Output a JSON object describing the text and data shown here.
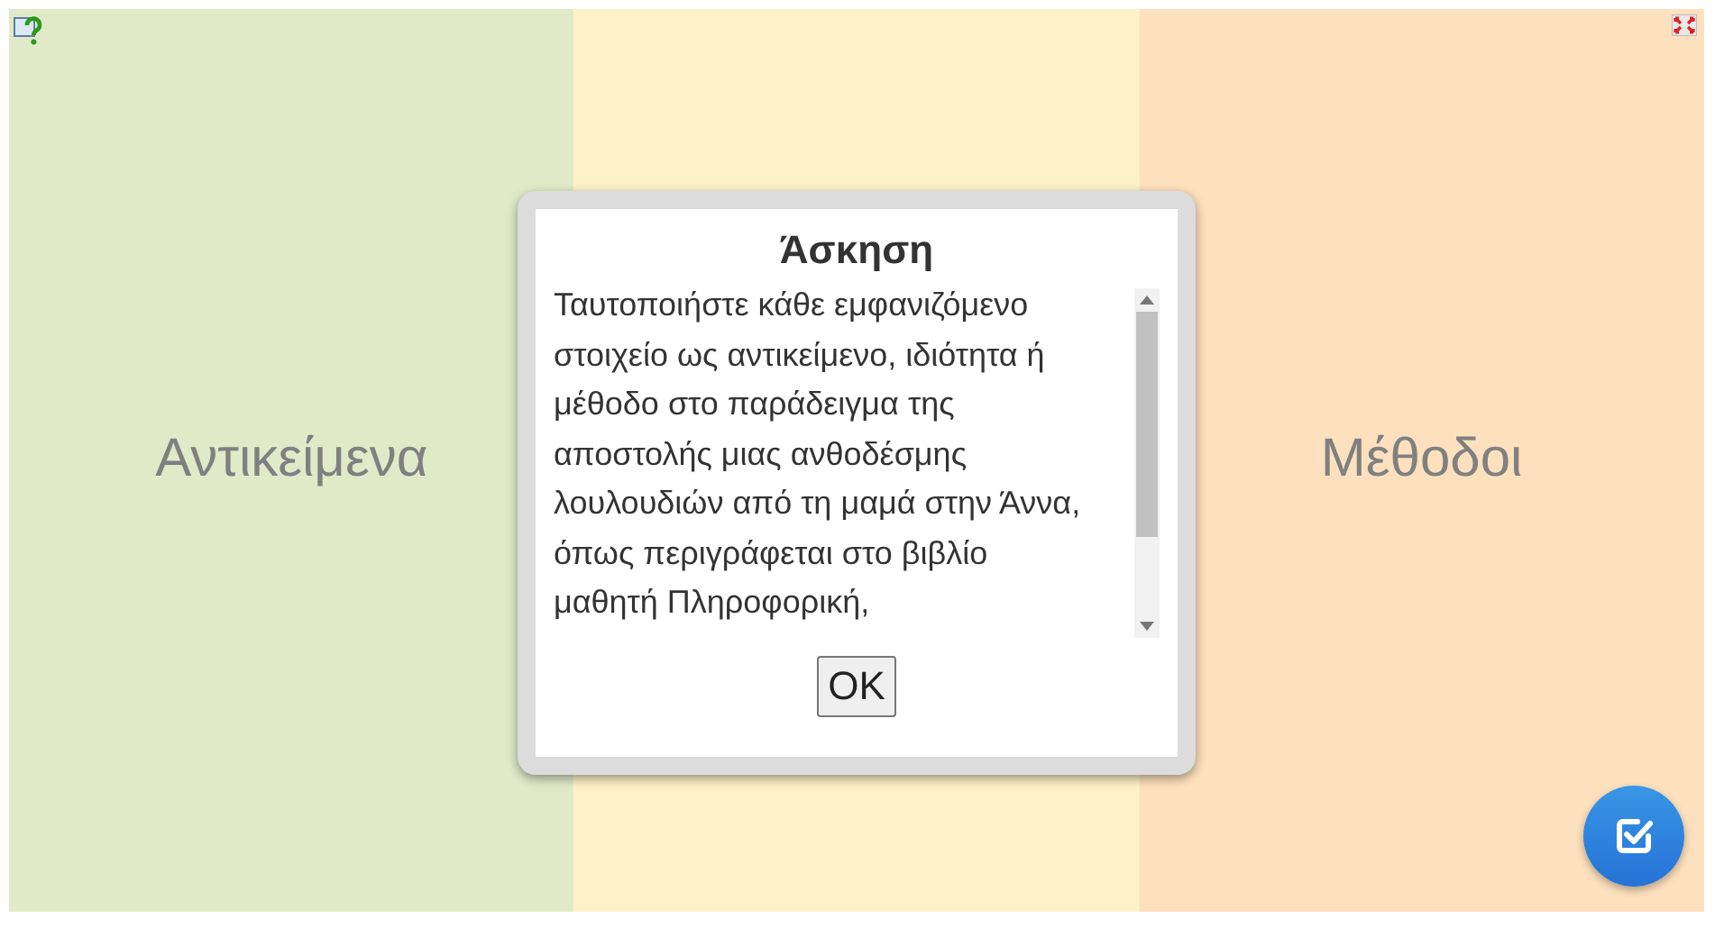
{
  "columns": [
    {
      "label": "Αντικείμενα",
      "color": "#e0eac8"
    },
    {
      "color": "#fdf1c8"
    },
    {
      "label": "Μέθοδοι",
      "color": "#fde0bd"
    }
  ],
  "dialog": {
    "title": "Άσκηση",
    "text": "Ταυτοποιήστε κάθε εμφανιζόμενο στοιχείο ως αντικείμενο, ιδιότητα ή μέθοδο στο παράδειγμα της αποστολής μιας ανθοδέσμης λουλουδιών από τη μαμά στην Άννα, όπως περιγράφεται στο βιβλίο μαθητή Πληροφορική,",
    "button": "OK"
  }
}
